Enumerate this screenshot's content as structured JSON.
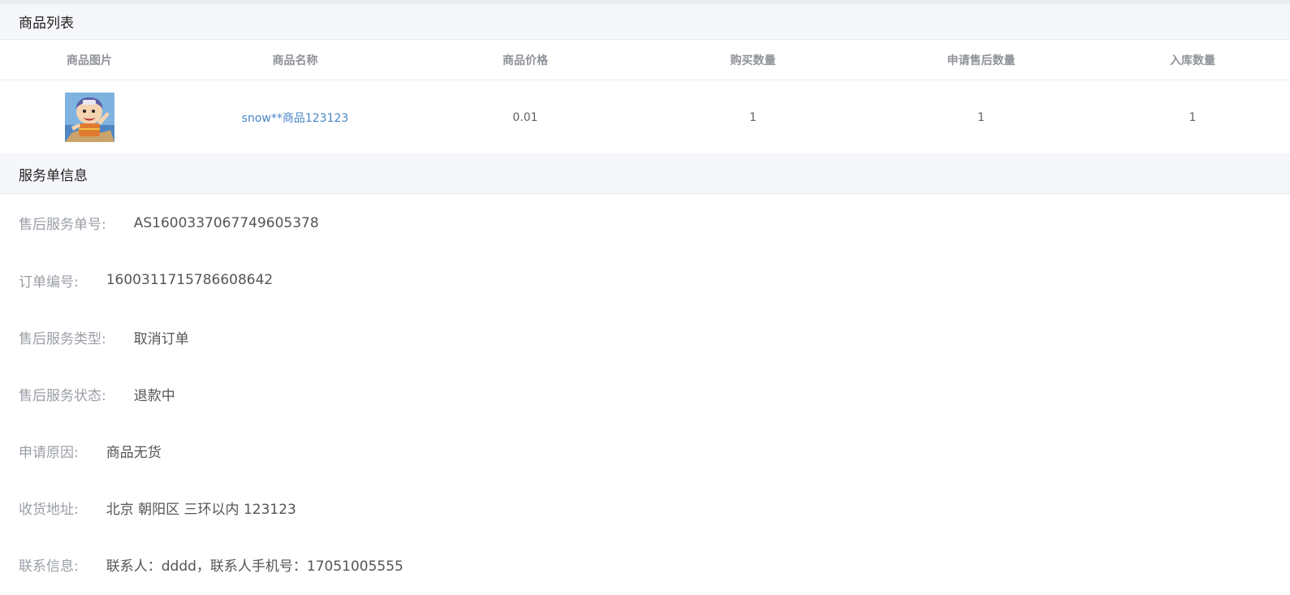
{
  "goods_section": {
    "title": "商品列表",
    "columns": [
      "商品图片",
      "商品名称",
      "商品价格",
      "购买数量",
      "申请售后数量",
      "入库数量"
    ],
    "rows": [
      {
        "image_icon": "cartoon-boy-product-image",
        "name": "snow**商品123123",
        "price": "0.01",
        "buy_qty": "1",
        "after_sale_qty": "1",
        "stock_qty": "1"
      }
    ]
  },
  "service_section": {
    "title": "服务单信息",
    "fields": [
      {
        "label": "售后服务单号:",
        "value": "AS1600337067749605378"
      },
      {
        "label": "订单编号:",
        "value": "1600311715786608642"
      },
      {
        "label": "售后服务类型:",
        "value": "取消订单"
      },
      {
        "label": "售后服务状态:",
        "value": "退款中"
      },
      {
        "label": "申请原因:",
        "value": "商品无货"
      },
      {
        "label": "收货地址:",
        "value": "北京 朝阳区 三环以内 123123"
      },
      {
        "label": "联系信息:",
        "value": "联系人：dddd，联系人手机号：17051005555"
      }
    ]
  },
  "colors": {
    "header_bg": "#f6f7fa",
    "link": "#4a86c8",
    "label": "#9a9ea6",
    "value": "#555555"
  }
}
